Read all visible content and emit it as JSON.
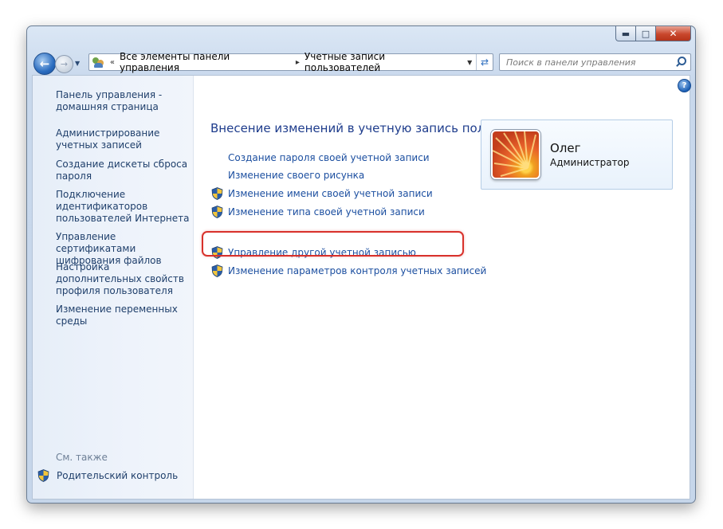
{
  "window": {
    "minimize": "▬",
    "maximize": "□",
    "close": "✕"
  },
  "nav": {
    "back_icon": "arrow-left-icon",
    "forward_icon": "arrow-right-icon"
  },
  "address": {
    "root_marker": "«",
    "crumbs": [
      "Все элементы панели управления",
      "Учетные записи пользователей"
    ],
    "separator": "▸"
  },
  "search": {
    "placeholder": "Поиск в панели управления"
  },
  "help": "?",
  "sidebar": {
    "links": [
      "Панель управления - домашняя страница",
      "Администрирование учетных записей",
      "Создание дискеты сброса пароля",
      "Подключение идентификаторов пользователей Интернета",
      "Управление сертификатами шифрования файлов",
      "Настройка дополнительных свойств профиля пользователя",
      "Изменение переменных среды"
    ],
    "see_also": "См. также",
    "parental_control": "Родительский контроль"
  },
  "main": {
    "title": "Внесение изменений в учетную запись пользователя",
    "tasks": [
      "Создание пароля своей учетной записи",
      "Изменение своего рисунка",
      "Изменение имени своей учетной записи",
      "Изменение типа своей учетной записи",
      "Управление другой учетной записью",
      "Изменение параметров контроля учетных записей"
    ]
  },
  "user": {
    "name": "Олег",
    "role": "Администратор"
  },
  "colors": {
    "link": "#1c4fa0",
    "title": "#1e3c8c",
    "highlight": "#d8312b"
  }
}
